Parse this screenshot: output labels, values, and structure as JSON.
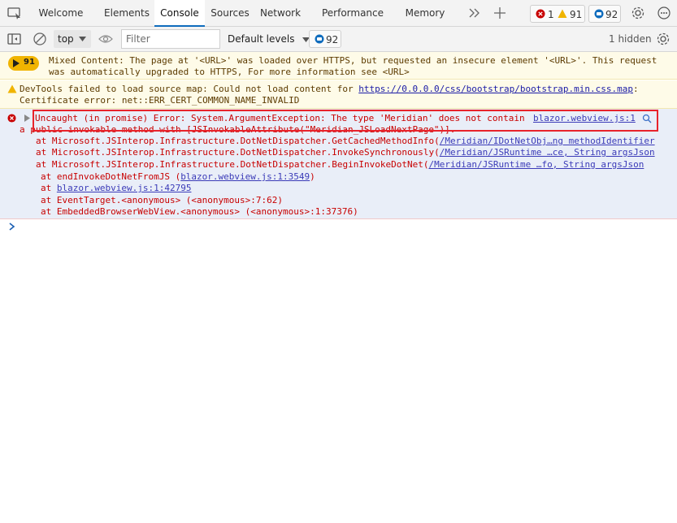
{
  "tabs": [
    {
      "label": "Welcome"
    },
    {
      "label": "Elements"
    },
    {
      "label": "Console"
    },
    {
      "label": "Sources"
    },
    {
      "label": "Network"
    },
    {
      "label": "Performance"
    },
    {
      "label": "Memory"
    }
  ],
  "badges": {
    "errors": "1",
    "warnings": "91",
    "issues": "92"
  },
  "toolbar": {
    "context": "top",
    "filter_placeholder": "Filter",
    "levels": "Default levels",
    "issues": "92",
    "hidden": "1 hidden"
  },
  "messages": {
    "mixed": {
      "count": "91",
      "line1": "Mixed Content: The page at '<URL>' was loaded over HTTPS, but requested an insecure element '<URL>'. This request",
      "line2": "was automatically upgraded to HTTPS, For more information see <URL>"
    },
    "sourcemap": {
      "prefix": "DevTools failed to load source map: Could not load content for ",
      "url": "https://0.0.0.0/css/bootstrap/bootstrap.min.css.map",
      "suffix": ":",
      "line2": "Certificate error: net::ERR_CERT_COMMON_NAME_INVALID"
    },
    "error": {
      "line1": "Uncaught (in promise) Error: System.ArgumentException: The type 'Meridian' does not contain",
      "source": "blazor.webview.js:1",
      "line2": "a public invokable method with [JSInvokableAttribute(\"Meridian_JSLoadNextPage\")].",
      "stack": [
        {
          "prefix": "at Microsoft.JSInterop.Infrastructure.DotNetDispatcher.GetCachedMethodInfo(",
          "link": "/Meridian/IDotNetObj…ng methodIdentifier"
        },
        {
          "prefix": "at Microsoft.JSInterop.Infrastructure.DotNetDispatcher.InvokeSynchronously(",
          "link": "/Meridian/JSRuntime …ce, String argsJson"
        },
        {
          "prefix": "at Microsoft.JSInterop.Infrastructure.DotNetDispatcher.BeginInvokeDotNet(",
          "link": "/Meridian/JSRuntime …fo, String argsJson"
        }
      ],
      "frames": [
        {
          "prefix": "at endInvokeDotNetFromJS (",
          "link": "blazor.webview.js:1:3549",
          "suffix": ")"
        },
        {
          "prefix": "at ",
          "link": "blazor.webview.js:1:42795",
          "suffix": ""
        },
        {
          "prefix": "at EventTarget.<anonymous> (<anonymous>:7:62)",
          "link": "",
          "suffix": ""
        },
        {
          "prefix": "at EmbeddedBrowserWebView.<anonymous> (<anonymous>:1:37376)",
          "link": "",
          "suffix": ""
        }
      ]
    }
  },
  "colors": {
    "accent": "#0f6cbd",
    "error": "#c80000",
    "warning": "#f0b400",
    "highlight": "#e8232b"
  }
}
